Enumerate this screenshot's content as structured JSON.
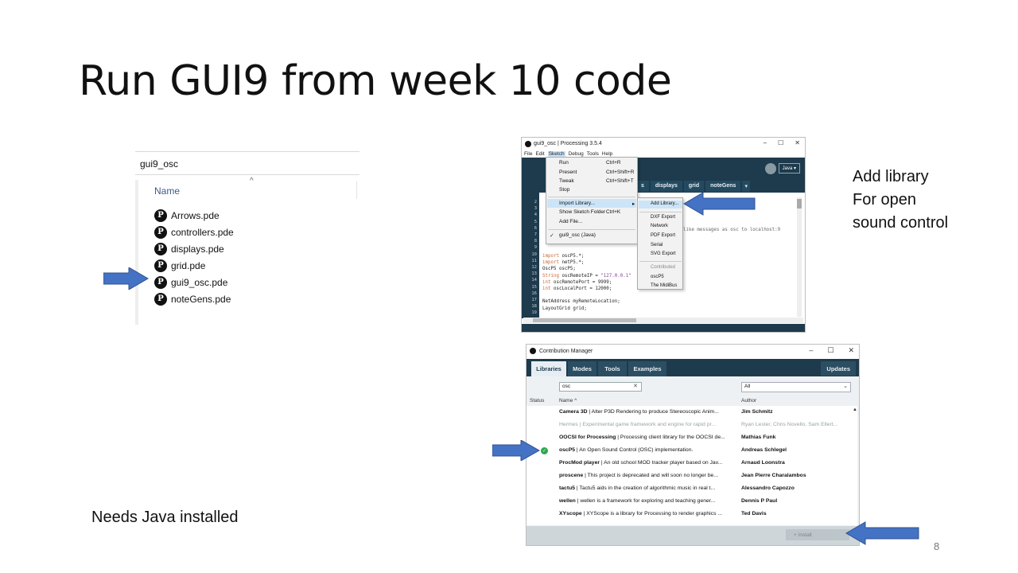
{
  "slide": {
    "title": "Run GUI9 from week 10 code",
    "side_note_lines": [
      "Add library",
      "For  open",
      "sound control"
    ],
    "bottom_note": "Needs Java installed",
    "page_number": "8"
  },
  "explorer": {
    "address": "gui9_osc",
    "column_header": "Name",
    "files": [
      "Arrows.pde",
      "controllers.pde",
      "displays.pde",
      "grid.pde",
      "gui9_osc.pde",
      "noteGens.pde"
    ],
    "file_icon_glyph": "P"
  },
  "ide": {
    "title": "gui9_osc | Processing 3.5.4",
    "window_controls": [
      "–",
      "☐",
      "✕"
    ],
    "menus": [
      "File",
      "Edit",
      "Sketch",
      "Debug",
      "Tools",
      "Help"
    ],
    "tabs": [
      "s",
      "displays",
      "grid",
      "noteGens",
      "▾"
    ],
    "mode_button": "Java ▾",
    "line_numbers": [
      "2",
      "3",
      "4",
      "5",
      "6",
      "7",
      "8",
      "9",
      "10",
      "11",
      "12",
      "13",
      "14",
      "15",
      "16",
      "17",
      "18",
      "19"
    ],
    "comment_text": "l like messages as osc to localhost:9",
    "code_lines": [
      {
        "parts": [
          {
            "t": "import",
            "c": "kw"
          },
          {
            "t": " oscP5.*;"
          }
        ]
      },
      {
        "parts": [
          {
            "t": "import",
            "c": "kw"
          },
          {
            "t": " netP5.*;"
          }
        ]
      },
      {
        "parts": [
          {
            "t": "OscP5 oscP5;"
          }
        ]
      },
      {
        "parts": [
          {
            "t": "String",
            "c": "kw"
          },
          {
            "t": " oscRemoteIP = "
          },
          {
            "t": "\"127.0.0.1\"",
            "c": "str"
          }
        ]
      },
      {
        "parts": [
          {
            "t": "int",
            "c": "kw"
          },
          {
            "t": " oscRemotePort = 9999;"
          }
        ]
      },
      {
        "parts": [
          {
            "t": "int",
            "c": "kw"
          },
          {
            "t": " oscLocalPort = 12000;"
          }
        ]
      },
      {
        "parts": [
          {
            "t": ""
          }
        ]
      },
      {
        "parts": [
          {
            "t": "NetAddress myRemoteLocation;"
          }
        ]
      },
      {
        "parts": [
          {
            "t": "LayoutGrid grid;"
          }
        ]
      }
    ],
    "sketch_menu": [
      {
        "label": "Run",
        "shortcut": "Ctrl+R"
      },
      {
        "label": "Present",
        "shortcut": "Ctrl+Shift+R"
      },
      {
        "label": "Tweak",
        "shortcut": "Ctrl+Shift+T"
      },
      {
        "label": "Stop",
        "shortcut": ""
      },
      {
        "label": "Import Library...",
        "shortcut": "▸"
      },
      {
        "label": "Show Sketch Folder",
        "shortcut": "Ctrl+K"
      },
      {
        "label": "Add File...",
        "shortcut": ""
      },
      {
        "label": "gui9_osc (Java)",
        "shortcut": ""
      }
    ],
    "checkmark": "✓",
    "import_menu": {
      "items": [
        "Add Library...",
        "DXF Export",
        "Network",
        "PDF Export",
        "Serial",
        "SVG Export"
      ],
      "contributed_header": "Contributed",
      "contributed": [
        "oscP5",
        "The MidiBus"
      ]
    }
  },
  "contribution_manager": {
    "title": "Contribution Manager",
    "window_controls": [
      "–",
      "☐",
      "✕"
    ],
    "tabs": [
      "Libraries",
      "Modes",
      "Tools",
      "Examples"
    ],
    "updates_label": "Updates",
    "search_value": "osc",
    "search_clear": "✕",
    "category_value": "All",
    "headers": {
      "status": "Status",
      "name": "Name ^",
      "author": "Author"
    },
    "rows": [
      {
        "name": "Camera 3D",
        "desc": " | Alter P3D Rendering to produce Stereoscopic Anim...",
        "author": "Jim Schmitz",
        "dim": false,
        "installed": false
      },
      {
        "name": "Hermes",
        "desc": " | Experimental game framework and engine for rapid pr...",
        "author": "Ryan Lester, Chris Novello, Sam Ellert...",
        "dim": true,
        "installed": false
      },
      {
        "name": "OOCSI for Processing",
        "desc": " | Processing client library for the OOCSI de...",
        "author": "Mathias Funk",
        "dim": false,
        "installed": false
      },
      {
        "name": "oscP5",
        "desc": " | An Open Sound Control (OSC) implementation.",
        "author": "Andreas Schlegel",
        "dim": false,
        "installed": true
      },
      {
        "name": "ProcMod player",
        "desc": " | An old school MOD tracker player based on Jav...",
        "author": "Arnaud Loonstra",
        "dim": false,
        "installed": false
      },
      {
        "name": "proscene",
        "desc": " | This project is deprecated and will soon no longer be...",
        "author": "Jean Pierre Charalambos",
        "dim": false,
        "installed": false
      },
      {
        "name": "tactu5",
        "desc": " | Tactu5 aids in the creation of algorithmic music in real t...",
        "author": "Alessandro Capozzo",
        "dim": false,
        "installed": false
      },
      {
        "name": "wellen",
        "desc": " | wellen is a framework for exploring and teaching gener...",
        "author": "Dennis P Paul",
        "dim": false,
        "installed": false
      },
      {
        "name": "XYscope",
        "desc": " | XYScope is a library for Processing to render graphics ...",
        "author": "Ted Davis",
        "dim": false,
        "installed": false
      }
    ],
    "install_label": "+  Install",
    "status_check": "✓",
    "dropdown_glyph": "⌄",
    "scroll_up_glyph": "▲"
  },
  "colors": {
    "arrow": "#4472c4",
    "processing_dark": "#1e3a4d",
    "installed_green": "#2fa84f"
  }
}
